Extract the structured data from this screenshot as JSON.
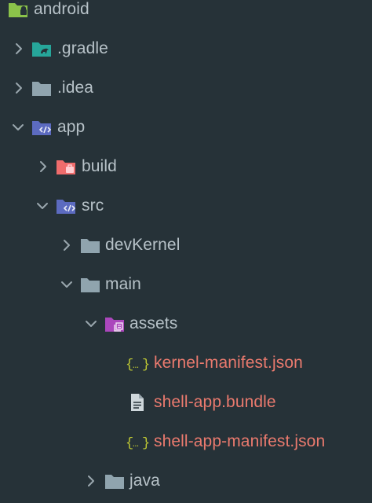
{
  "colors": {
    "background": "#263238",
    "folder_label": "#B7C2C8",
    "file_label": "#EA7A6E",
    "chevron": "#9AA7AE",
    "folder_default": "#90A4AE",
    "folder_android": "#8BC34A",
    "folder_gradle": "#26A69A",
    "folder_app": "#5C6BC0",
    "folder_build": "#EF6C6C",
    "folder_assets": "#AB47BC",
    "json_icon": "#C0CA33",
    "file_icon": "#CFD8DC"
  },
  "tree": {
    "items": [
      {
        "label": "android",
        "icon": "android-folder-icon",
        "chevron": "none"
      },
      {
        "label": ".gradle",
        "icon": "gradle-folder-icon",
        "chevron": "collapsed"
      },
      {
        "label": ".idea",
        "icon": "folder-icon",
        "chevron": "collapsed"
      },
      {
        "label": "app",
        "icon": "code-folder-icon",
        "chevron": "expanded"
      },
      {
        "label": "build",
        "icon": "build-folder-icon",
        "chevron": "collapsed"
      },
      {
        "label": "src",
        "icon": "code-folder-icon",
        "chevron": "expanded"
      },
      {
        "label": "devKernel",
        "icon": "folder-icon",
        "chevron": "collapsed"
      },
      {
        "label": "main",
        "icon": "folder-icon",
        "chevron": "expanded"
      },
      {
        "label": "assets",
        "icon": "assets-folder-icon",
        "chevron": "expanded"
      },
      {
        "label": "kernel-manifest.json",
        "icon": "json-file-icon",
        "chevron": "none"
      },
      {
        "label": "shell-app.bundle",
        "icon": "document-file-icon",
        "chevron": "none"
      },
      {
        "label": "shell-app-manifest.json",
        "icon": "json-file-icon",
        "chevron": "none"
      },
      {
        "label": "java",
        "icon": "folder-icon",
        "chevron": "collapsed"
      }
    ]
  }
}
